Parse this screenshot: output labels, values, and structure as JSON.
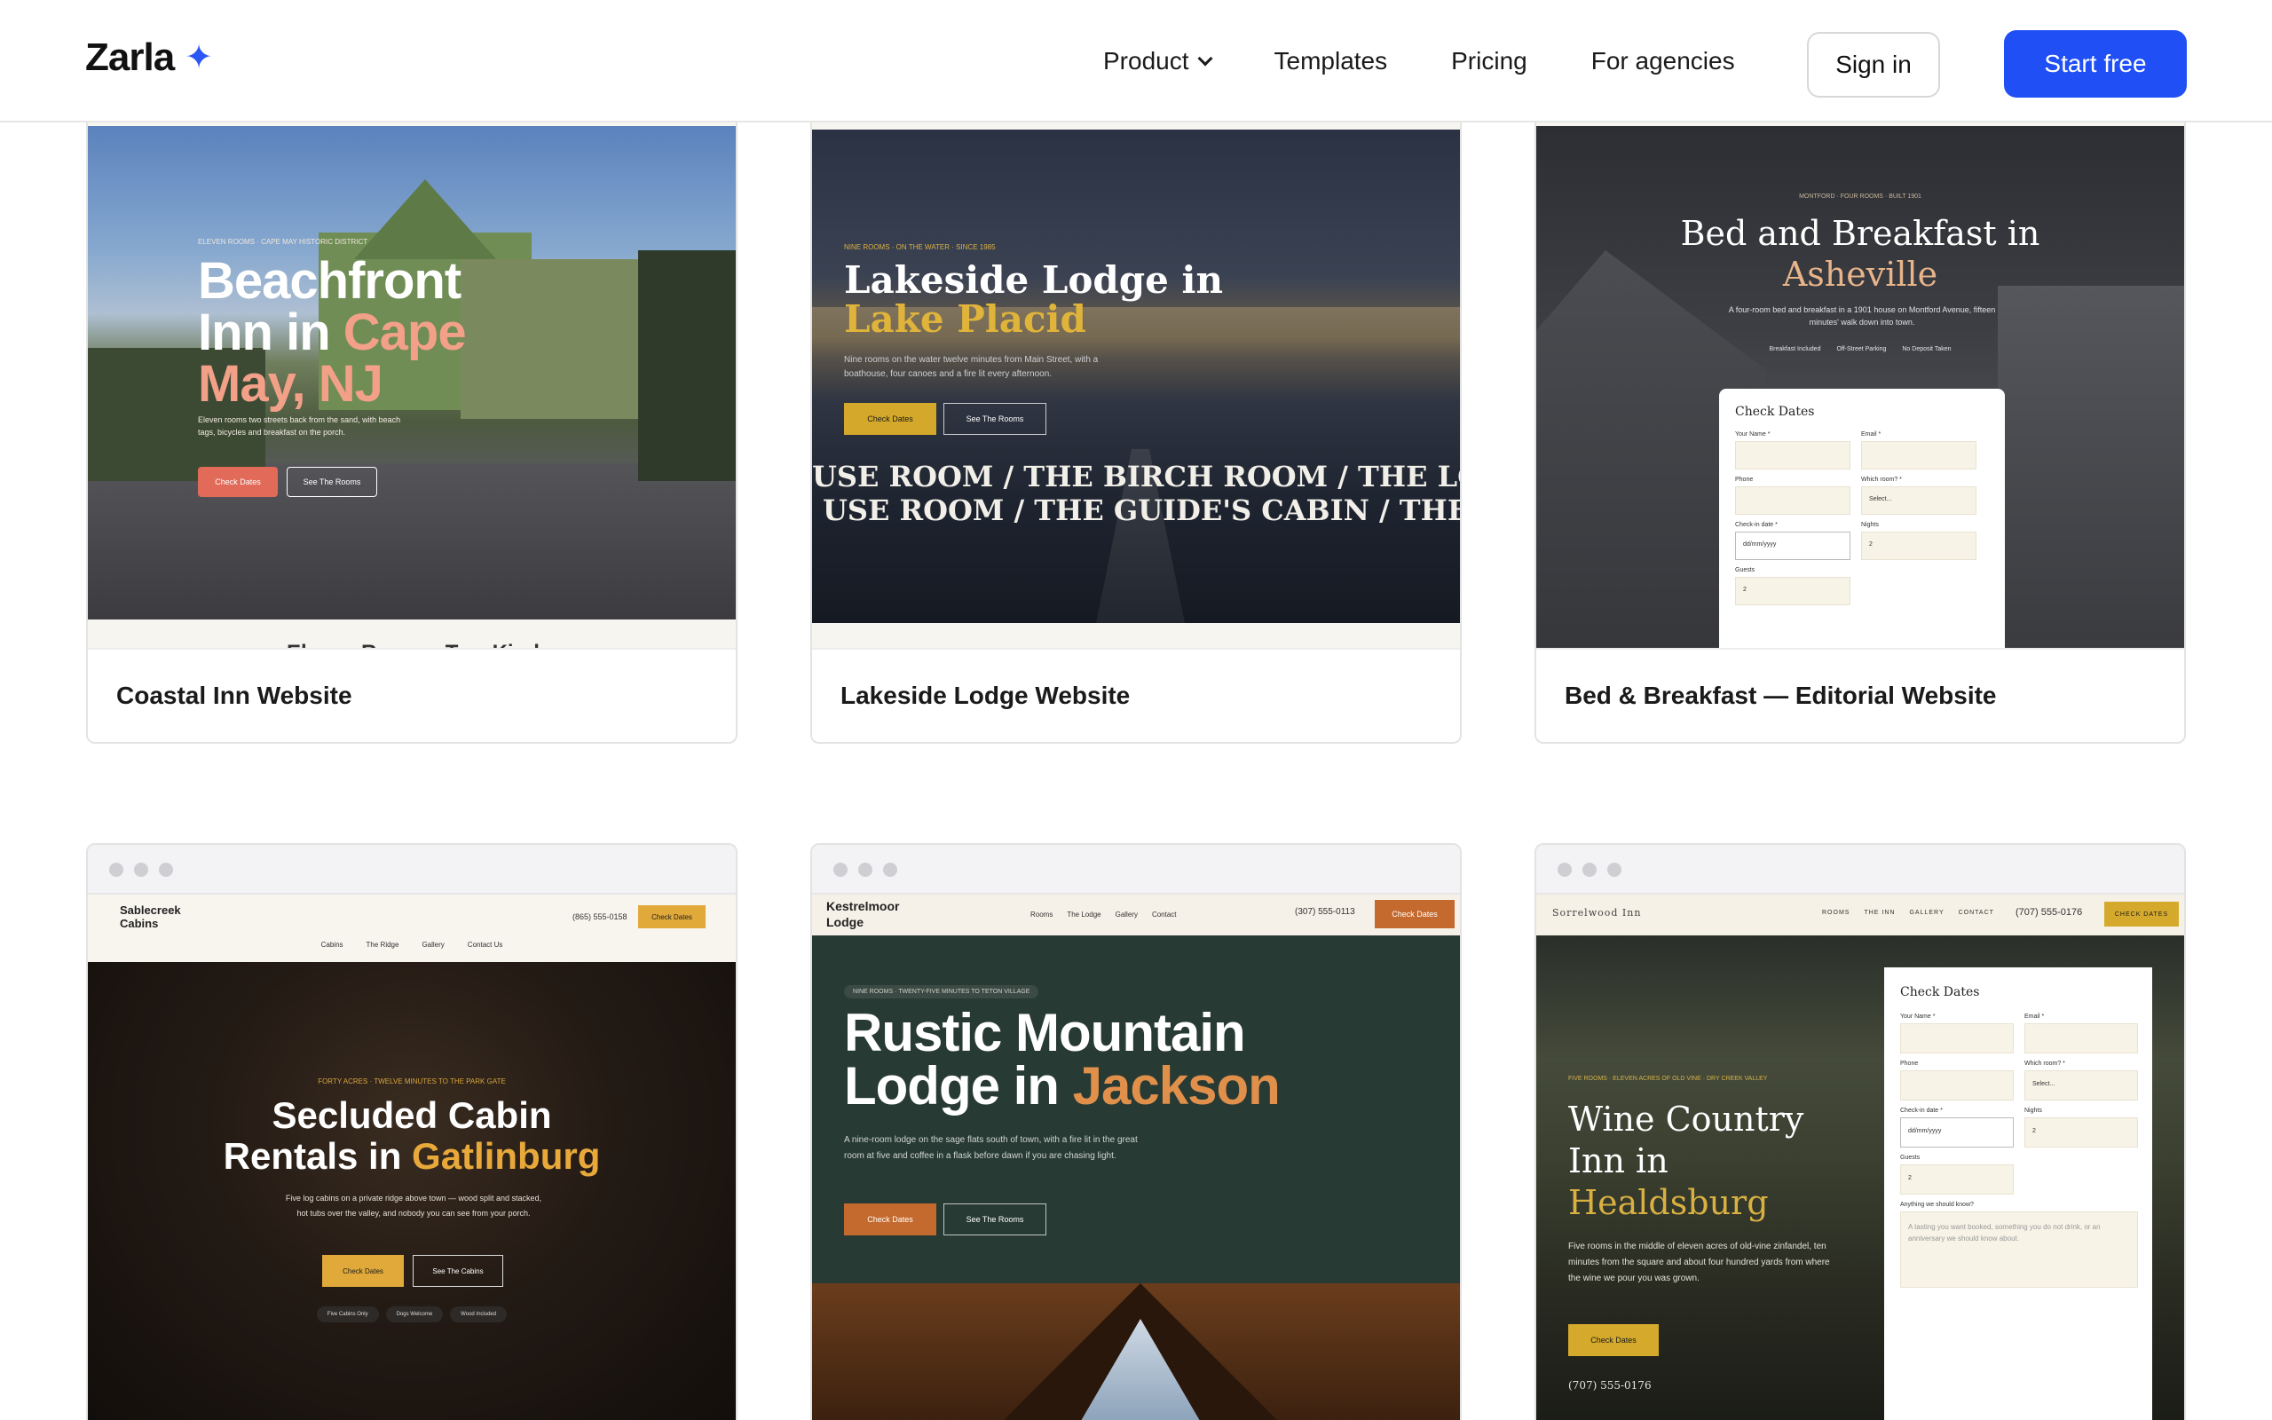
{
  "brand": {
    "name": "Zarla",
    "accent": "#1f4ff5"
  },
  "nav": {
    "links": [
      "Product",
      "Templates",
      "Pricing",
      "For agencies"
    ],
    "signin": "Sign in",
    "start": "Start free"
  },
  "cards": [
    {
      "title": "Coastal Inn Website",
      "eyebrow": "ELEVEN ROOMS · CAPE MAY HISTORIC DISTRICT",
      "h1_a": "Beachfront",
      "h1_b": "Inn in ",
      "h1_c": "Cape",
      "h1_d": "May, NJ",
      "body": "Eleven rooms two streets back from the sand, with beach tags, bicycles and breakfast on the porch.",
      "cta1": "Check Dates",
      "cta2": "See The Rooms",
      "peek": "Eleven Rooms, Two Kinds"
    },
    {
      "title": "Lakeside Lodge Website",
      "eyebrow": "NINE ROOMS · ON THE WATER · SINCE 1985",
      "h1_a": "Lakeside Lodge in",
      "h1_b": "Lake Placid",
      "body": "Nine rooms on the water twelve minutes from Main Street, with a boathouse, four canoes and a fire lit every afternoon.",
      "cta1": "Check Dates",
      "cta2": "See The Rooms",
      "marquee1": "USE ROOM / THE BIRCH ROOM / THE LOON",
      "marquee2": "USE ROOM / THE GUIDE'S CABIN / THE LOON"
    },
    {
      "title": "Bed & Breakfast — Editorial Website",
      "eyebrow": "MONTFORD · FOUR ROOMS · BUILT 1901",
      "h1_a": "Bed and Breakfast in",
      "h1_b": "Asheville",
      "body": "A four-room bed and breakfast in a 1901 house on Montford Avenue, fifteen minutes' walk down into town.",
      "badges": [
        "Breakfast Included",
        "Off-Street Parking",
        "No Deposit Taken"
      ],
      "form_title": "Check Dates",
      "labels": [
        "Your Name *",
        "Email *",
        "Phone",
        "Which room? *",
        "Check-in date *",
        "Nights",
        "Guests"
      ],
      "select_placeholder": "Select...",
      "date_placeholder": "dd/mm/yyyy",
      "nights": "2",
      "guests": "2"
    },
    {
      "brand": "Sablecreek Cabins",
      "phone": "(865) 555-0158",
      "cta_nav": "Check Dates",
      "menu": [
        "Cabins",
        "The Ridge",
        "Gallery",
        "Contact Us"
      ],
      "eyebrow": "FORTY ACRES · TWELVE MINUTES TO THE PARK GATE",
      "h1_a": "Secluded Cabin",
      "h1_b": "Rentals in ",
      "h1_c": "Gatlinburg",
      "body": "Five log cabins on a private ridge above town — wood split and stacked, hot tubs over the valley, and nobody you can see from your porch.",
      "cta1": "Check Dates",
      "cta2": "See The Cabins",
      "chips": [
        "Five Cabins Only",
        "Dogs Welcome",
        "Wood Included"
      ]
    },
    {
      "brand": "Kestrelmoor Lodge",
      "menu": [
        "Rooms",
        "The Lodge",
        "Gallery",
        "Contact"
      ],
      "phone": "(307) 555-0113",
      "cta_nav": "Check Dates",
      "eyebrow": "NINE ROOMS · TWENTY-FIVE MINUTES TO TETON VILLAGE",
      "h1_a": "Rustic Mountain",
      "h1_b": "Lodge in ",
      "h1_c": "Jackson",
      "body": "A nine-room lodge on the sage flats south of town, with a fire lit in the great room at five and coffee in a flask before dawn if you are chasing light.",
      "cta1": "Check Dates",
      "cta2": "See The Rooms"
    },
    {
      "brand": "Sorrelwood Inn",
      "menu": [
        "ROOMS",
        "THE INN",
        "GALLERY",
        "CONTACT"
      ],
      "phone": "(707) 555-0176",
      "cta_nav": "CHECK DATES",
      "eyebrow": "FIVE ROOMS · ELEVEN ACRES OF OLD VINE · DRY CREEK VALLEY",
      "h1_a": "Wine Country",
      "h1_b": "Inn in",
      "h1_c": "Healdsburg",
      "body": "Five rooms in the middle of eleven acres of old-vine zinfandel, ten minutes from the square and about four hundred yards from where the wine we pour you was grown.",
      "cta1": "Check Dates",
      "phone_bottom": "(707) 555-0176",
      "form_title": "Check Dates",
      "labels": [
        "Your Name *",
        "Email *",
        "Phone",
        "Which room? *",
        "Check-in date *",
        "Nights",
        "Guests",
        "Anything we should know?"
      ],
      "select_placeholder": "Select...",
      "date_placeholder": "dd/mm/yyyy",
      "nights": "2",
      "guests": "2",
      "textarea_placeholder": "A tasting you want booked, something you do not drink, or an anniversary we should know about."
    }
  ]
}
